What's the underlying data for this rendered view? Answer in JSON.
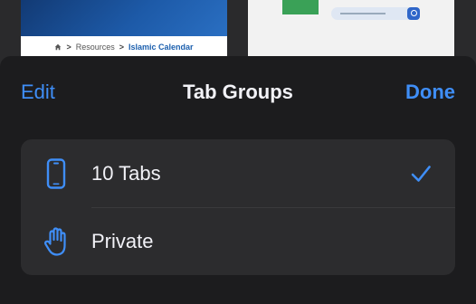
{
  "background_tabs": {
    "left": {
      "breadcrumb": [
        "Resources",
        "Islamic Calendar"
      ]
    }
  },
  "sheet": {
    "nav": {
      "edit_label": "Edit",
      "title": "Tab Groups",
      "done_label": "Done"
    },
    "groups": [
      {
        "label": "10 Tabs",
        "icon": "phone-icon",
        "selected": true
      },
      {
        "label": "Private",
        "icon": "hand-icon",
        "selected": false
      }
    ]
  },
  "colors": {
    "accent": "#3f8ef7",
    "sheet_bg": "#1c1c1e",
    "row_bg": "#2c2c2e",
    "text": "#f2f2f7"
  }
}
